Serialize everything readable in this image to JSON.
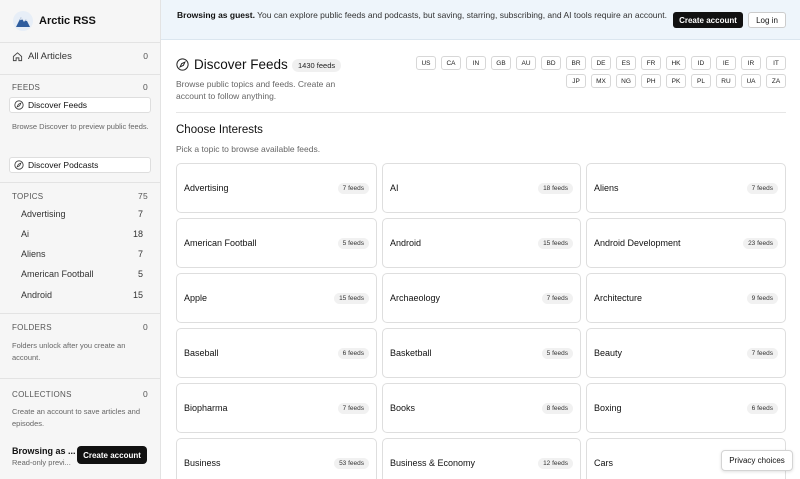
{
  "brand": {
    "name": "Arctic RSS"
  },
  "sidebar": {
    "all_articles": {
      "label": "All Articles",
      "count": "0"
    },
    "feeds": {
      "label": "FEEDS",
      "count": "0"
    },
    "discover_feeds": "Discover Feeds",
    "discover_note": "Browse Discover to preview public feeds.",
    "discover_podcasts": "Discover Podcasts",
    "topics": {
      "label": "TOPICS",
      "count": "75"
    },
    "topic_items": [
      {
        "label": "Advertising",
        "count": "7"
      },
      {
        "label": "Ai",
        "count": "18"
      },
      {
        "label": "Aliens",
        "count": "7"
      },
      {
        "label": "American Football",
        "count": "5"
      },
      {
        "label": "Android",
        "count": "15"
      }
    ],
    "folders": {
      "label": "FOLDERS",
      "count": "0"
    },
    "folders_note": "Folders unlock after you create an account.",
    "collections": {
      "label": "COLLECTIONS",
      "count": "0"
    },
    "collections_note": "Create an account to save articles and episodes.",
    "guest": {
      "title": "Browsing as ...",
      "subtitle": "Read-only previ..."
    },
    "create_account": "Create account"
  },
  "banner": {
    "strong": "Browsing as guest.",
    "text": " You can explore public feeds and podcasts, but saving, starring, subscribing, and AI tools require an account.",
    "create_account": "Create account",
    "login": "Log in"
  },
  "main": {
    "title": "Discover Feeds",
    "feed_count": "1430 feeds",
    "description": "Browse public topics and feeds. Create an account to follow anything.",
    "countries": [
      "US",
      "CA",
      "IN",
      "GB",
      "AU",
      "BD",
      "BR",
      "DE",
      "ES",
      "FR",
      "HK",
      "ID",
      "IE",
      "IR",
      "IT",
      "JP",
      "MX",
      "NG",
      "PH",
      "PK",
      "PL",
      "RU",
      "UA",
      "ZA"
    ],
    "section_title": "Choose Interests",
    "section_desc": "Pick a topic to browse available feeds.",
    "interests": [
      {
        "name": "Advertising",
        "count": "7 feeds"
      },
      {
        "name": "AI",
        "count": "18 feeds"
      },
      {
        "name": "Aliens",
        "count": "7 feeds"
      },
      {
        "name": "American Football",
        "count": "5 feeds"
      },
      {
        "name": "Android",
        "count": "15 feeds"
      },
      {
        "name": "Android Development",
        "count": "23 feeds"
      },
      {
        "name": "Apple",
        "count": "15 feeds"
      },
      {
        "name": "Archaeology",
        "count": "7 feeds"
      },
      {
        "name": "Architecture",
        "count": "9 feeds"
      },
      {
        "name": "Baseball",
        "count": "6 feeds"
      },
      {
        "name": "Basketball",
        "count": "5 feeds"
      },
      {
        "name": "Beauty",
        "count": "7 feeds"
      },
      {
        "name": "Biopharma",
        "count": "7 feeds"
      },
      {
        "name": "Books",
        "count": "8 feeds"
      },
      {
        "name": "Boxing",
        "count": "6 feeds"
      },
      {
        "name": "Business",
        "count": "53 feeds"
      },
      {
        "name": "Business & Economy",
        "count": "12 feeds"
      },
      {
        "name": "Cars",
        "count": ""
      }
    ]
  },
  "privacy": "Privacy choices"
}
